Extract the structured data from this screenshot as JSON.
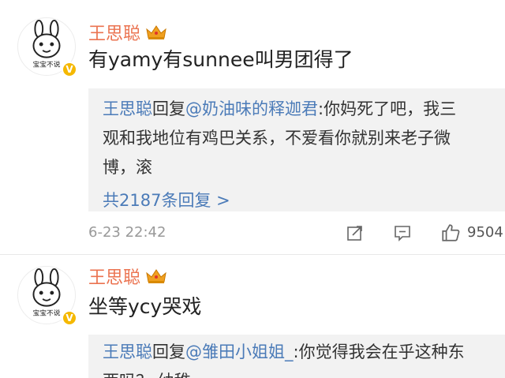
{
  "comments": [
    {
      "username": "王思聪",
      "avatar_text": "宝宝不说",
      "verified_badge": "V",
      "text": "有yamy有sunnee叫男团得了",
      "reply": {
        "author": "王思聪",
        "action": "回复",
        "target": "@奶油味的释迦君",
        "line1": ":你妈死了吧，我三",
        "line2": "观和我地位有鸡巴关系，不爱看你就别来老子微",
        "line3": "博，滚",
        "more": "共2187条回复 >"
      },
      "timestamp": "6-23 22:42",
      "likes": "9504"
    },
    {
      "username": "王思聪",
      "avatar_text": "宝宝不说",
      "verified_badge": "V",
      "text": "坐等ycy哭戏",
      "reply": {
        "author": "王思聪",
        "action": "回复",
        "target": "@雏田小姐姐_",
        "line1": ":你觉得我会在乎这种东",
        "line2": "西吗？ 幼稚"
      }
    }
  ],
  "icons": {
    "share": "share-icon",
    "comment": "comment-icon",
    "like": "thumbs-up-icon",
    "crown": "crown-icon"
  },
  "colors": {
    "username": "#eb7350",
    "link": "#4b7bb8",
    "reply_bg": "#f2f2f2",
    "badge": "#f5b800"
  }
}
